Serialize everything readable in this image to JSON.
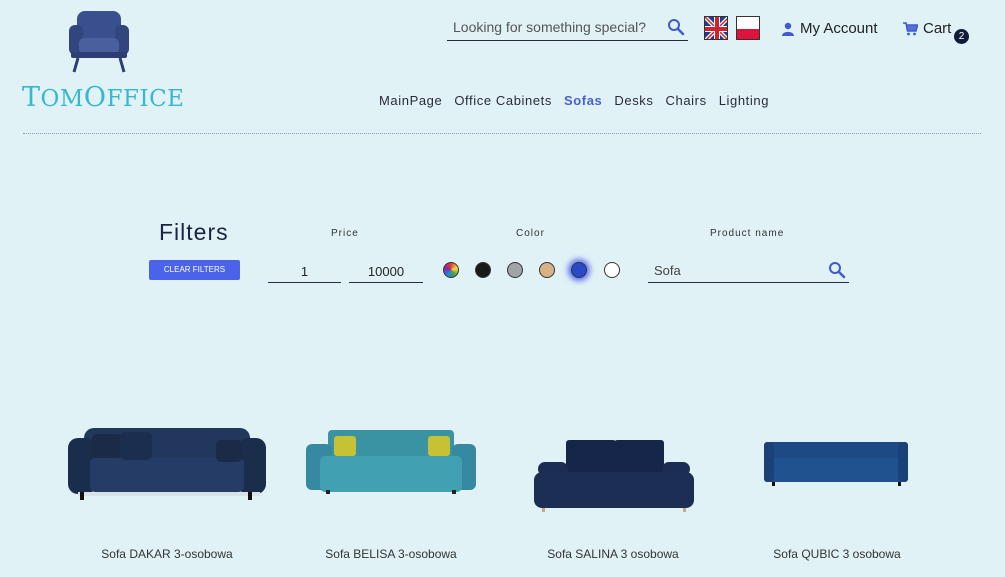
{
  "brand": {
    "name_parts": [
      "T",
      "OM",
      "O",
      "FFICE"
    ]
  },
  "header": {
    "search_placeholder": "Looking for something special?",
    "account_label": "My Account",
    "cart_label": "Cart",
    "cart_count": "2",
    "flags": [
      "uk-flag-icon",
      "pl-flag-icon"
    ]
  },
  "nav": {
    "items": [
      "MainPage",
      "Office Cabinets",
      "Sofas",
      "Desks",
      "Chairs",
      "Lighting"
    ],
    "active": "Sofas"
  },
  "filters": {
    "title": "Filters",
    "clear_label": "CLEAR FILTERS",
    "price_label": "Price",
    "price_min": "1",
    "price_max": "10000",
    "color_label": "Color",
    "colors": [
      {
        "name": "multicolor",
        "value": "rainbow"
      },
      {
        "name": "black",
        "value": "#1a1a1a"
      },
      {
        "name": "grey",
        "value": "#a0a4a8"
      },
      {
        "name": "beige",
        "value": "#d8b287"
      },
      {
        "name": "blue",
        "value": "#2a49c9",
        "selected": true
      },
      {
        "name": "white",
        "value": "#ffffff"
      }
    ],
    "name_label": "Product name",
    "name_value": "Sofa"
  },
  "products": [
    {
      "name": "Sofa DAKAR 3-osobowa",
      "color": "#1f3357"
    },
    {
      "name": "Sofa BELISA 3-osobowa",
      "color": "#3c98a8"
    },
    {
      "name": "Sofa SALINA 3 osobowa",
      "color": "#1b2d4f"
    },
    {
      "name": "Sofa QUBIC 3 osobowa",
      "color": "#1f4c86"
    }
  ],
  "colors": {
    "accent": "#4a63e8",
    "background": "#e0f2f5",
    "logo": "#35b8d0",
    "active_nav": "#4a5fd6"
  }
}
